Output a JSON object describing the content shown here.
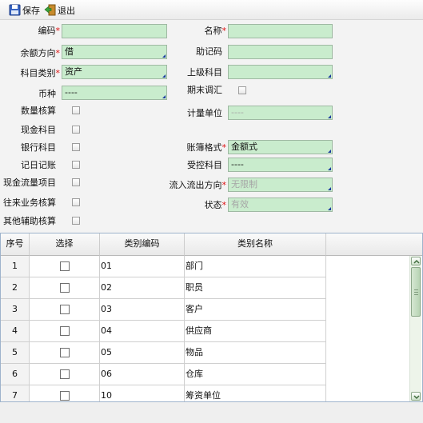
{
  "toolbar": {
    "save_label": "保存",
    "exit_label": "退出"
  },
  "form": {
    "code": {
      "label": "编码",
      "required": "*",
      "value": ""
    },
    "name": {
      "label": "名称",
      "required": "*",
      "value": ""
    },
    "balance_dir": {
      "label": "余额方向",
      "required": "*",
      "value": "借"
    },
    "mnemonic": {
      "label": "助记码",
      "value": ""
    },
    "subject_type": {
      "label": "科目类别",
      "required": "*",
      "value": "资产"
    },
    "parent_subject": {
      "label": "上级科目",
      "value": ""
    },
    "currency": {
      "label": "币种",
      "value": "----"
    },
    "period_adjust": {
      "label": "期末调汇"
    },
    "qty_accounting": {
      "label": "数量核算"
    },
    "unit": {
      "label": "计量单位",
      "value": "----"
    },
    "cash_subject": {
      "label": "现金科目"
    },
    "bank_subject": {
      "label": "银行科目"
    },
    "ledger_format": {
      "label": "账簿格式",
      "required": "*",
      "value": "金额式"
    },
    "daily_journal": {
      "label": "记日记账"
    },
    "controlled": {
      "label": "受控科目",
      "value": "----"
    },
    "cashflow_item": {
      "label": "现金流量项目"
    },
    "flow_direction": {
      "label": "流入流出方向",
      "required": "*",
      "value": "无限制"
    },
    "ar_ap": {
      "label": "往来业务核算"
    },
    "status": {
      "label": "状态",
      "required": "*",
      "value": "有效"
    },
    "other_aux": {
      "label": "其他辅助核算"
    }
  },
  "grid": {
    "headers": [
      "序号",
      "选择",
      "类别编码",
      "类别名称"
    ],
    "rows": [
      {
        "num": "1",
        "code": "01",
        "name": "部门"
      },
      {
        "num": "2",
        "code": "02",
        "name": "职员"
      },
      {
        "num": "3",
        "code": "03",
        "name": "客户"
      },
      {
        "num": "4",
        "code": "04",
        "name": "供应商"
      },
      {
        "num": "5",
        "code": "05",
        "name": "物品"
      },
      {
        "num": "6",
        "code": "06",
        "name": "仓库"
      },
      {
        "num": "7",
        "code": "10",
        "name": "筹资单位"
      }
    ]
  },
  "icons": {
    "save": "floppy-disk-icon",
    "exit": "exit-door-icon",
    "dropdown": "dropdown-triangle-icon"
  },
  "colors": {
    "field_bg": "#c9eccd",
    "required_star": "#dd1111",
    "dropdown_triangle": "#1c3aa0"
  }
}
